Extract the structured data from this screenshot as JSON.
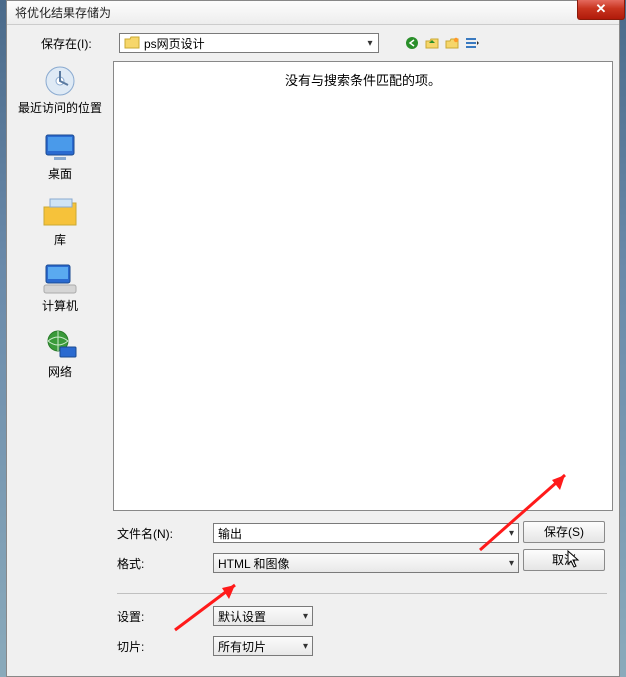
{
  "dialog_title": "将优化结果存储为",
  "close_glyph": "✕",
  "location": {
    "label": "保存在(I):",
    "folder": "ps网页设计"
  },
  "places": {
    "recent": "最近访问的位置",
    "desktop": "桌面",
    "libraries": "库",
    "computer": "计算机",
    "network": "网络"
  },
  "filearea": {
    "empty": "没有与搜索条件匹配的项。"
  },
  "fields": {
    "filename_label": "文件名(N):",
    "filename_value": "输出",
    "format_label": "格式:",
    "format_value": "HTML 和图像",
    "settings_label": "设置:",
    "settings_value": "默认设置",
    "slices_label": "切片:",
    "slices_value": "所有切片"
  },
  "buttons": {
    "save": "保存(S)",
    "cancel": "取消"
  }
}
